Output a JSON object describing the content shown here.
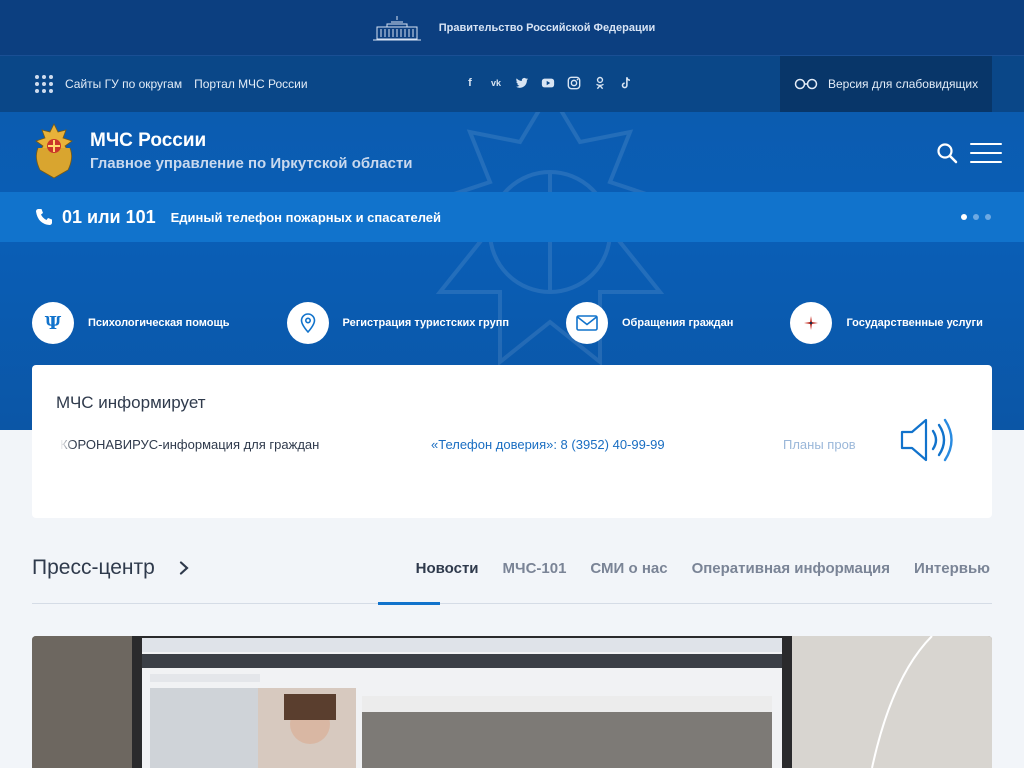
{
  "gov_bar": {
    "label": "Правительство Российской Федерации"
  },
  "top_nav": {
    "links": [
      "Сайты ГУ по округам",
      "Портал МЧС России"
    ],
    "social": [
      "facebook-icon",
      "vk-icon",
      "twitter-icon",
      "youtube-icon",
      "instagram-icon",
      "odnoklassniki-icon",
      "tiktok-icon"
    ],
    "vision_label": "Версия для слабовидящих"
  },
  "brand": {
    "title": "МЧС России",
    "subtitle": "Главное управление по Иркутской области"
  },
  "phone_bar": {
    "number": "01 или 101",
    "description": "Единый телефон пожарных и спасателей",
    "slides": 3,
    "active_slide": 1
  },
  "services": [
    {
      "label": "Психологическая помощь",
      "icon": "psi-icon"
    },
    {
      "label": "Регистрация туристских групп",
      "icon": "location-pin-icon"
    },
    {
      "label": "Обращения граждан",
      "icon": "mail-icon"
    },
    {
      "label": "Государственные услуги",
      "icon": "compass-star-icon"
    }
  ],
  "info": {
    "title": "МЧС информирует",
    "ticker": [
      "КОРОНАВИРУС-информация для граждан",
      "«Телефон доверия»: 8 (3952) 40-99-99",
      "Планы пров"
    ]
  },
  "press": {
    "title": "Пресс-центр",
    "tabs": [
      "Новости",
      "МЧС-101",
      "СМИ о нас",
      "Оперативная информация",
      "Интервью"
    ],
    "active_tab": "Новости"
  },
  "colors": {
    "dark_blue": "#0c3f80",
    "hero_blue": "#0a5eb6",
    "accent_blue": "#1173cc",
    "page_bg": "#f2f5f9"
  }
}
